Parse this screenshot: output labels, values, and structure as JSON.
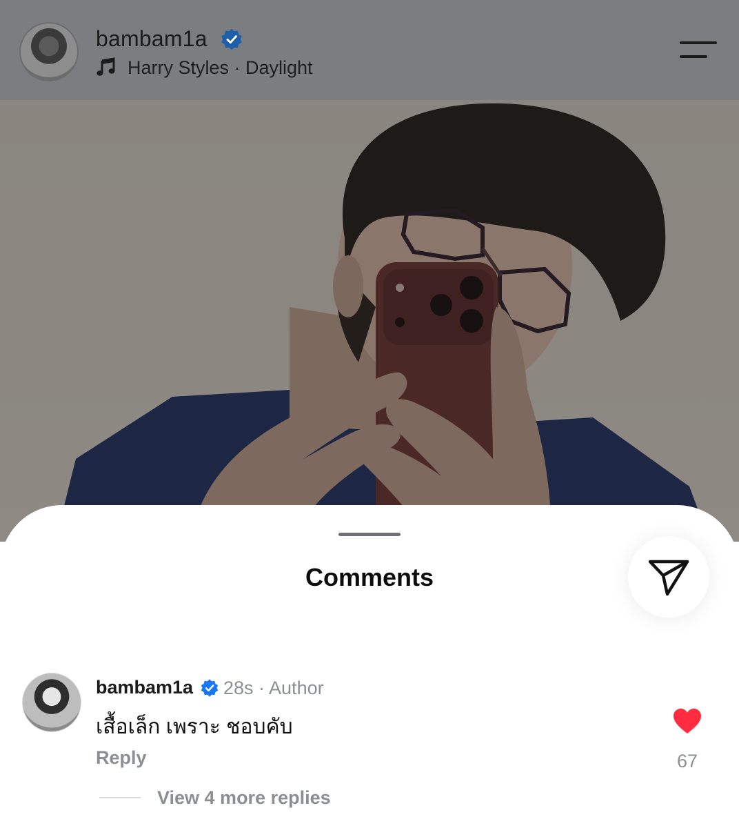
{
  "header": {
    "username": "bambam1a",
    "verified": true,
    "song": "Harry Styles · Daylight",
    "icons": {
      "music": "music-note-icon",
      "menu": "menu-icon",
      "verified": "verified-badge-icon"
    }
  },
  "photo": {
    "description_icon": "post-photo"
  },
  "sheet": {
    "title": "Comments",
    "share_icon": "send-icon"
  },
  "comment": {
    "username": "bambam1a",
    "verified": true,
    "meta": "28s · Author",
    "text": "เสื้อเล็ก เพราะ ชอบคับ",
    "reply_label": "Reply",
    "like_count": "67",
    "liked": true,
    "view_replies": "View 4 more replies"
  },
  "colors": {
    "verified_blue": "#1877f2",
    "like_red": "#ff2d3f",
    "muted_text": "#8b8f94",
    "header_dim": "#7b7d80"
  }
}
